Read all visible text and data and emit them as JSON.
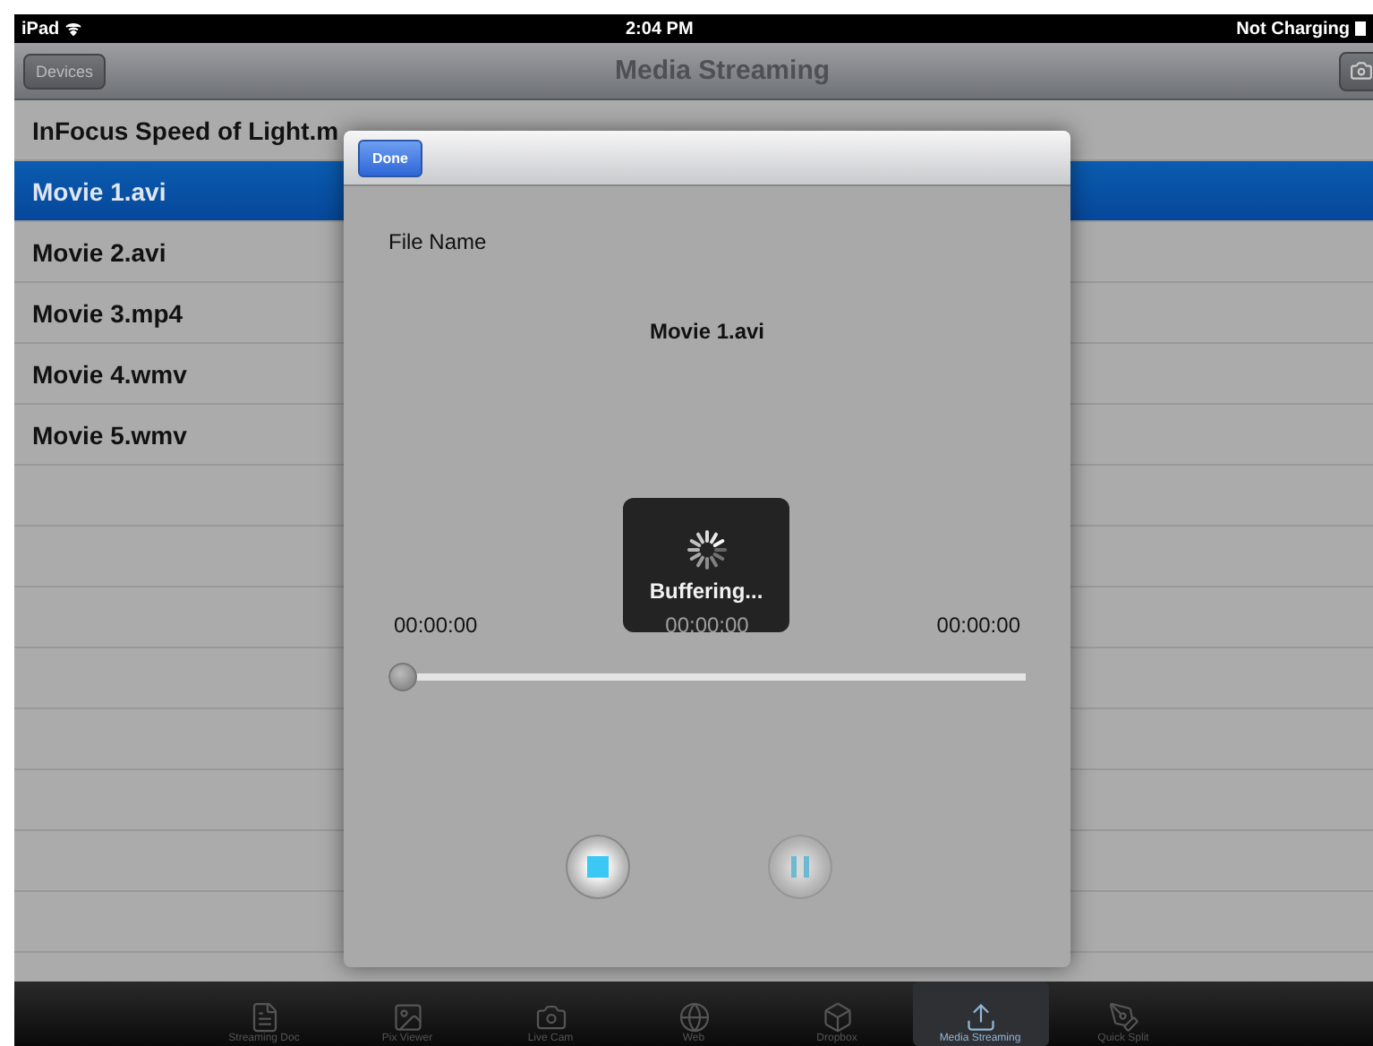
{
  "status_bar": {
    "device": "iPad",
    "time": "2:04 PM",
    "battery": "Not Charging"
  },
  "nav_bar": {
    "title": "Media Streaming",
    "left_button": "Devices"
  },
  "files": [
    {
      "name": "InFocus Speed of Light.m",
      "selected": false
    },
    {
      "name": "Movie 1.avi",
      "selected": true
    },
    {
      "name": "Movie 2.avi",
      "selected": false
    },
    {
      "name": "Movie 3.mp4",
      "selected": false
    },
    {
      "name": "Movie 4.wmv",
      "selected": false
    },
    {
      "name": "Movie 5.wmv",
      "selected": false
    }
  ],
  "player": {
    "done_button": "Done",
    "file_name_label": "File Name",
    "file_name": "Movie 1.avi",
    "hud": "Buffering...",
    "time_elapsed": "00:00:00",
    "time_center": "00:00:00",
    "time_total": "00:00:00",
    "progress": {
      "level": 0
    },
    "stop_disabled": false,
    "pause_disabled": true
  },
  "tab_bar": [
    {
      "label": "Streaming Doc",
      "selected": false
    },
    {
      "label": "Pix Viewer",
      "selected": false
    },
    {
      "label": "Live Cam",
      "selected": false
    },
    {
      "label": "Web",
      "selected": false
    },
    {
      "label": "Dropbox",
      "selected": false
    },
    {
      "label": "Media Streaming",
      "selected": true
    },
    {
      "label": "Quick Split",
      "selected": false
    }
  ]
}
